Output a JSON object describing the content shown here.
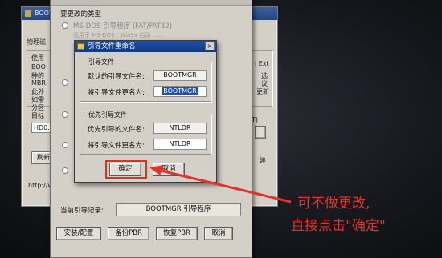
{
  "back_window": {
    "title": "BOOTI",
    "tab_label": "物理磁",
    "partial_texts": [
      "使用",
      "BOO",
      "种的",
      "MBR",
      "此外",
      "如需",
      "分区",
      "目标",
      "HD0:",
      "刷新",
      "http://w",
      "l Ext",
      "选",
      "议",
      "更新",
      "T)",
      "建"
    ]
  },
  "main_dialog": {
    "section_title": "要更改的类型",
    "options": [
      {
        "label": "MS-DOS 引导程序 (FAT/FAT32)",
        "desc": "适用于 MS-DOS / Win9x 启动 ……"
      }
    ],
    "current_record_label": "当前引导记录:",
    "current_record_value": "BOOTMGR 引导程序",
    "buttons": {
      "install": "安装/配置",
      "backup": "备份PBR",
      "restore": "恢复PBR",
      "cancel": "取消"
    }
  },
  "rename_dialog": {
    "title": "引导文件重命名",
    "close_glyph": "×",
    "group1": {
      "label": "引导文件",
      "default_name_label": "默认的引导文件名:",
      "default_name_value": "BOOTMGR",
      "rename_label": "将引导文件更名为:",
      "rename_value": "BOOTMGR"
    },
    "group2": {
      "label": "优先引导文件",
      "default_name_label": "优先引导的文件名:",
      "default_name_value": "NTLDR",
      "rename_label": "将引导文件更名为:",
      "rename_value": "NTLDR"
    },
    "ok": "确定",
    "cancel": "取消"
  },
  "annotation": {
    "line1": "可不做更改,",
    "line2": "直接点击\"确定\"",
    "color": "#e2332a"
  }
}
